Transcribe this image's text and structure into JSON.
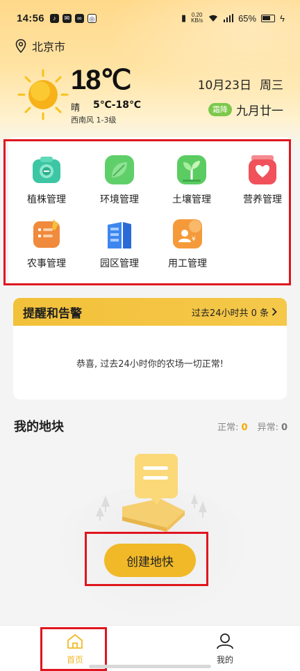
{
  "status_bar": {
    "time": "14:56",
    "net_speed_value": "0.20",
    "net_speed_unit": "KB/s",
    "battery": "65%"
  },
  "location": {
    "city": "北京市",
    "icon": "location-pin-icon"
  },
  "weather": {
    "temperature": "18℃",
    "condition": "晴",
    "range": "5℃-18℃",
    "wind": "西南风 1-3级",
    "icon": "sun-icon"
  },
  "date": {
    "day": "10月23日",
    "weekday": "周三",
    "solar_term": "霜降",
    "lunar": "九月廿一"
  },
  "functions": [
    {
      "label": "植株管理",
      "icon": "plant-camera-icon",
      "color": "#3cc6a4"
    },
    {
      "label": "环境管理",
      "icon": "leaf-icon",
      "color": "#5fcf6a"
    },
    {
      "label": "土壤管理",
      "icon": "sprout-icon",
      "color": "#5bcc62"
    },
    {
      "label": "营养管理",
      "icon": "heart-jar-icon",
      "color": "#f0515a"
    },
    {
      "label": "农事管理",
      "icon": "notebook-icon",
      "color": "#f08a3c"
    },
    {
      "label": "园区管理",
      "icon": "building-icon",
      "color": "#3d86f0"
    },
    {
      "label": "用工管理",
      "icon": "worker-pay-icon",
      "color": "#f59a3a"
    }
  ],
  "alerts": {
    "title": "提醒和告警",
    "summary": "过去24小时共 0 条",
    "message": "恭喜, 过去24小时你的农场一切正常!"
  },
  "plots": {
    "title": "我的地块",
    "normal_label": "正常:",
    "normal_count": "0",
    "abnormal_label": "异常:",
    "abnormal_count": "0",
    "create_label": "创建地快"
  },
  "nav": {
    "home": "首页",
    "mine": "我的",
    "active_color": "#f1b928"
  }
}
